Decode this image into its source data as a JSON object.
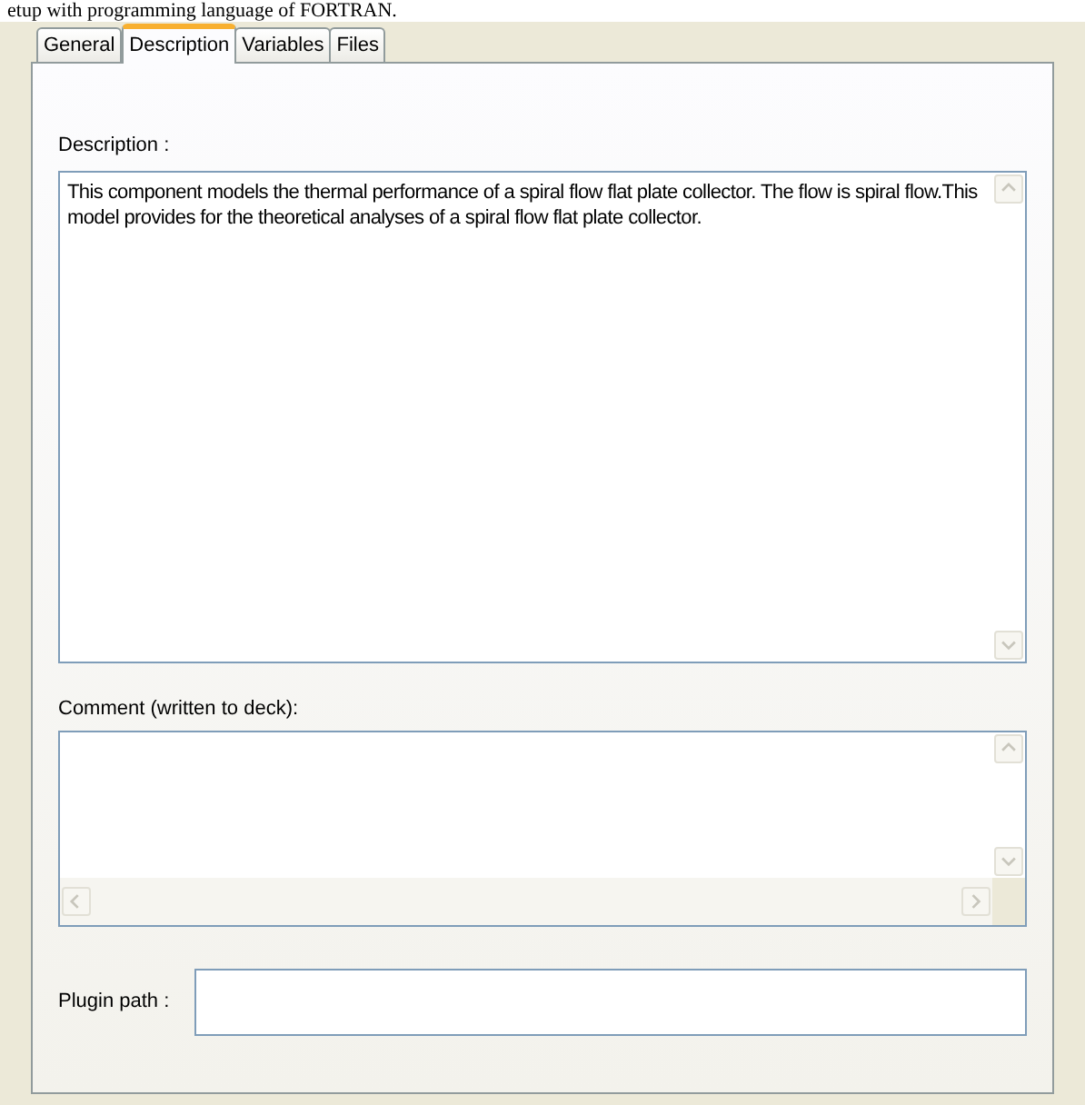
{
  "caption": "etup with programming language of FORTRAN.",
  "tabs": [
    {
      "label": "General",
      "selected": false
    },
    {
      "label": "Description",
      "selected": true
    },
    {
      "label": "Variables",
      "selected": false
    },
    {
      "label": "Files",
      "selected": false
    }
  ],
  "description": {
    "label": "Description :",
    "value": "This component models the thermal performance of a spiral flow flat plate collector. The flow is spiral flow.This model provides for the theoretical analyses of a spiral flow flat plate collector."
  },
  "comment": {
    "label": "Comment (written to deck):"
  },
  "plugin_path": {
    "label": "Plugin path :"
  }
}
